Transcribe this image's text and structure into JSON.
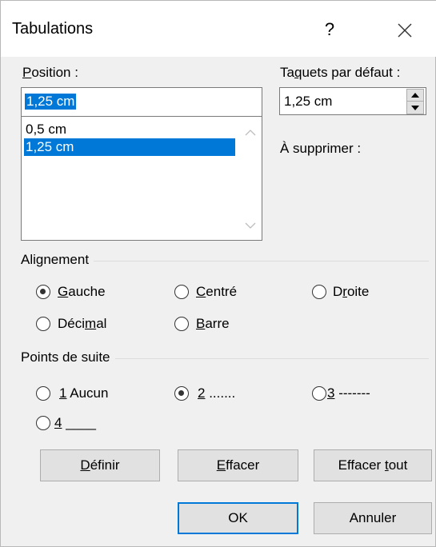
{
  "dialog": {
    "title": "Tabulations",
    "help_label": "?"
  },
  "position": {
    "label_first": "P",
    "label_rest": "osition :",
    "value": "1,25 cm",
    "list": [
      "0,5 cm",
      "1,25 cm"
    ],
    "selected_index": 1
  },
  "default_tabs": {
    "label_pre": "Ta",
    "label_ul": "q",
    "label_post": "uets par défaut :",
    "value": "1,25 cm"
  },
  "to_clear": {
    "label": "À supprimer :"
  },
  "alignment": {
    "title": "Alignement",
    "options": [
      {
        "pre": "",
        "ul": "G",
        "post": "auche",
        "selected": true
      },
      {
        "pre": "",
        "ul": "C",
        "post": "entré",
        "selected": false
      },
      {
        "pre": "D",
        "ul": "r",
        "post": "oite",
        "selected": false
      },
      {
        "pre": "Déci",
        "ul": "m",
        "post": "al",
        "selected": false
      },
      {
        "pre": "",
        "ul": "B",
        "post": "arre",
        "selected": false
      }
    ]
  },
  "leader": {
    "title": "Points de suite",
    "options": [
      {
        "ul": "1",
        "post": " Aucun",
        "selected": false
      },
      {
        "ul": "2",
        "post": " .......",
        "selected": true
      },
      {
        "ul": "3",
        "post": " -------",
        "selected": false
      },
      {
        "ul": "4",
        "post": " ____",
        "selected": false
      }
    ]
  },
  "buttons": {
    "set": {
      "ul": "D",
      "post": "éfinir"
    },
    "clear": {
      "ul": "E",
      "post": "ffacer"
    },
    "clear_all": {
      "pre": "Effacer ",
      "ul": "t",
      "post": "out"
    },
    "ok": "OK",
    "cancel": "Annuler"
  },
  "colors": {
    "selection": "#0078d7",
    "dialog_bg": "#f0f0f0"
  }
}
